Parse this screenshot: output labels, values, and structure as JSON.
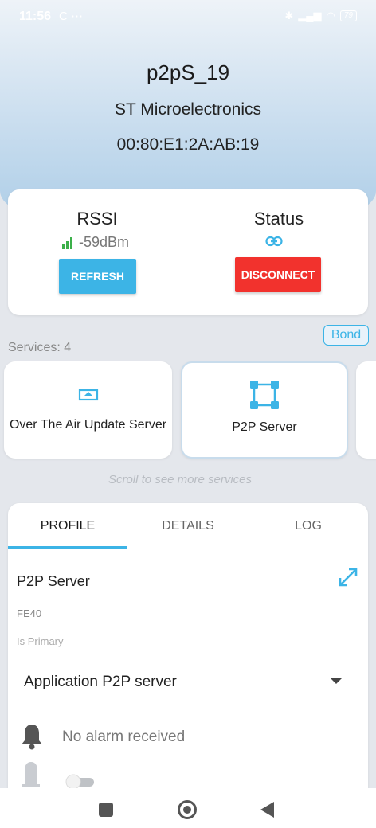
{
  "status_bar": {
    "time": "11:56",
    "left_icons": "C ⋯",
    "battery": "79"
  },
  "device": {
    "name": "p2pS_19",
    "manufacturer": "ST Microelectronics",
    "mac": "00:80:E1:2A:AB:19"
  },
  "rssi": {
    "title": "RSSI",
    "value": "-59dBm",
    "refresh_label": "REFRESH"
  },
  "status": {
    "title": "Status",
    "disconnect_label": "DISCONNECT"
  },
  "bond_label": "Bond",
  "services": {
    "count_label": "Services: 4",
    "items": [
      {
        "label": "Over The Air Update Server",
        "icon": "ota-upload-icon"
      },
      {
        "label": "P2P Server",
        "icon": "p2p-network-icon"
      }
    ],
    "scroll_hint": "Scroll to see more services"
  },
  "tabs": [
    {
      "label": "PROFILE"
    },
    {
      "label": "DETAILS"
    },
    {
      "label": "LOG"
    }
  ],
  "profile": {
    "service_name": "P2P Server",
    "uuid": "FE40",
    "primary_label": "Is Primary",
    "selected_profile": "Application P2P server",
    "alarm_text": "No alarm received"
  },
  "colors": {
    "accent": "#3cb4e6",
    "danger": "#f2322d",
    "signal": "#3cb04a"
  }
}
